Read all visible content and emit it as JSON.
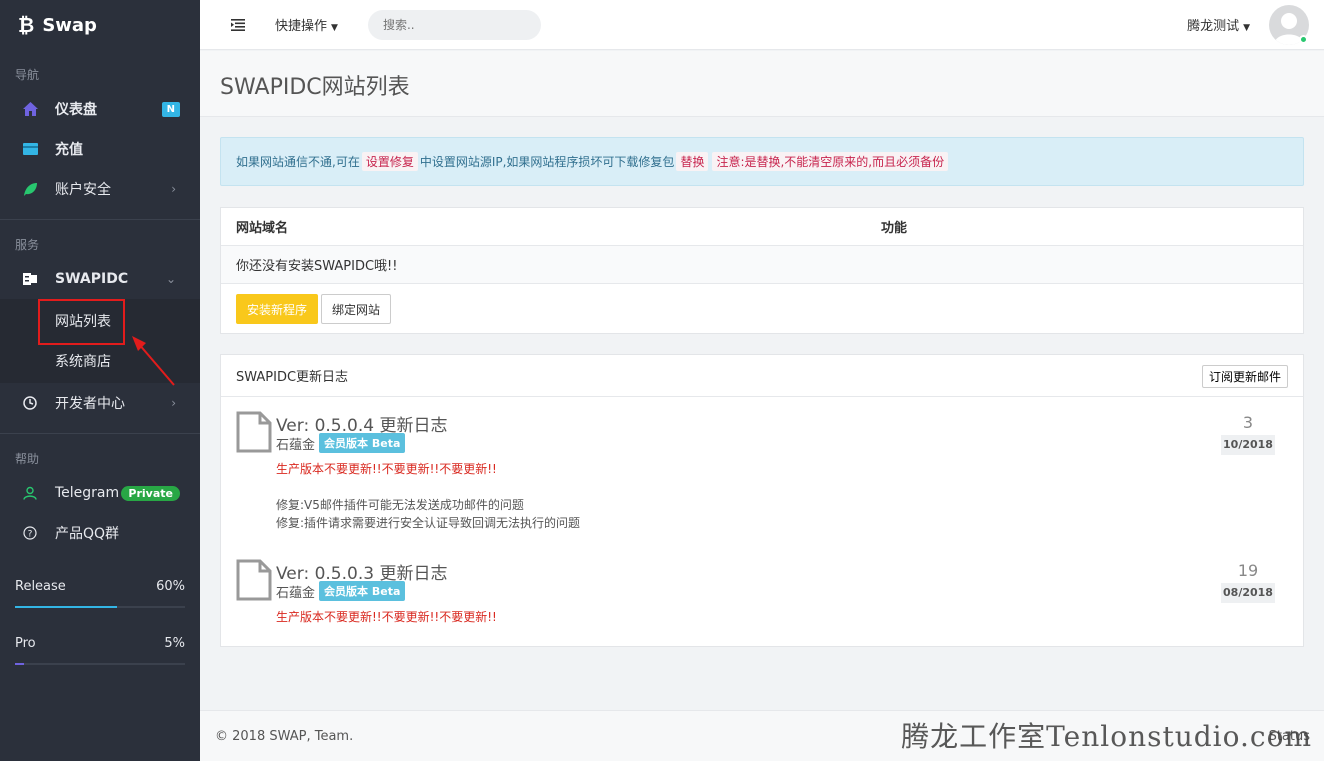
{
  "sidebar": {
    "brand": "Swap",
    "sections": {
      "nav": "导航",
      "services": "服务",
      "help": "帮助"
    },
    "items": {
      "dashboard": "仪表盘",
      "dashboard_badge": "N",
      "recharge": "充值",
      "security": "账户安全",
      "swapidc": "SWAPIDC",
      "site_list": "网站列表",
      "store": "系统商店",
      "dev_center": "开发者中心",
      "telegram": "Telegram",
      "telegram_badge": "Private",
      "qq_group": "产品QQ群"
    },
    "progress": [
      {
        "label": "Release",
        "value_text": "60%",
        "value": 60
      },
      {
        "label": "Pro",
        "value_text": "5%",
        "value": 5
      }
    ]
  },
  "header": {
    "quick_actions": "快捷操作",
    "search_placeholder": "搜索..",
    "user_name": "腾龙测试"
  },
  "page": {
    "title": "SWAPIDC网站列表"
  },
  "alert": {
    "text1": "如果网站通信不通,可在",
    "code1": "设置修复",
    "text2": "中设置网站源IP,如果网站程序损坏可下载修复包",
    "code2": "替换",
    "code3": "注意:是替换,不能清空原来的,而且必须备份"
  },
  "sites_table": {
    "col_domain": "网站域名",
    "col_function": "功能",
    "empty_text": "你还没有安装SWAPIDC哦!!",
    "install_button": "安装新程序",
    "bind_button": "绑定网站"
  },
  "changelog": {
    "title": "SWAPIDC更新日志",
    "subscribe_button": "订阅更新邮件",
    "entries": [
      {
        "title": "Ver: 0.5.0.4 更新日志",
        "author": "石蕴金",
        "badge": "会员版本 Beta",
        "warning": "生产版本不要更新!!不要更新!!不要更新!!",
        "lines": [
          "修复:V5邮件插件可能无法发送成功邮件的问题",
          "修复:插件请求需要进行安全认证导致回调无法执行的问题"
        ],
        "day": "3",
        "month": "10/2018"
      },
      {
        "title": "Ver: 0.5.0.3 更新日志",
        "author": "石蕴金",
        "badge": "会员版本 Beta",
        "warning": "生产版本不要更新!!不要更新!!不要更新!!",
        "lines": [],
        "day": "19",
        "month": "08/2018"
      }
    ]
  },
  "footer": {
    "copyright": "© 2018 SWAP, Team.",
    "status": "Status"
  },
  "watermark": "腾龙工作室Tenlonstudio.com"
}
